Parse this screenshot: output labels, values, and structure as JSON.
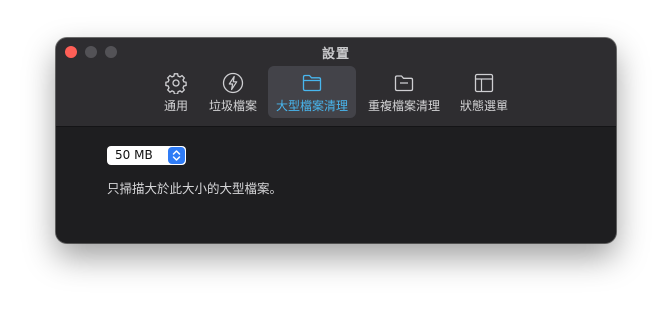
{
  "window": {
    "title": "設置"
  },
  "toolbar": {
    "tabs": [
      {
        "label": "通用",
        "icon": "gear-icon"
      },
      {
        "label": "垃圾檔案",
        "icon": "lightning-icon"
      },
      {
        "label": "大型檔案清理",
        "icon": "folder-icon",
        "active": true
      },
      {
        "label": "重複檔案清理",
        "icon": "folder-duplicate-icon"
      },
      {
        "label": "狀態選單",
        "icon": "menu-layout-icon"
      }
    ]
  },
  "settings": {
    "size_select": {
      "value": "50 MB"
    },
    "hint": "只掃描大於此大小的大型檔案。"
  },
  "colors": {
    "window_background": "#1e1e20",
    "toolbar_background": "#2e2d30",
    "active_tab_background": "#434349",
    "accent": "#48b6ee",
    "stepper": "#2f7cf6",
    "close_button": "#fe5f57"
  }
}
